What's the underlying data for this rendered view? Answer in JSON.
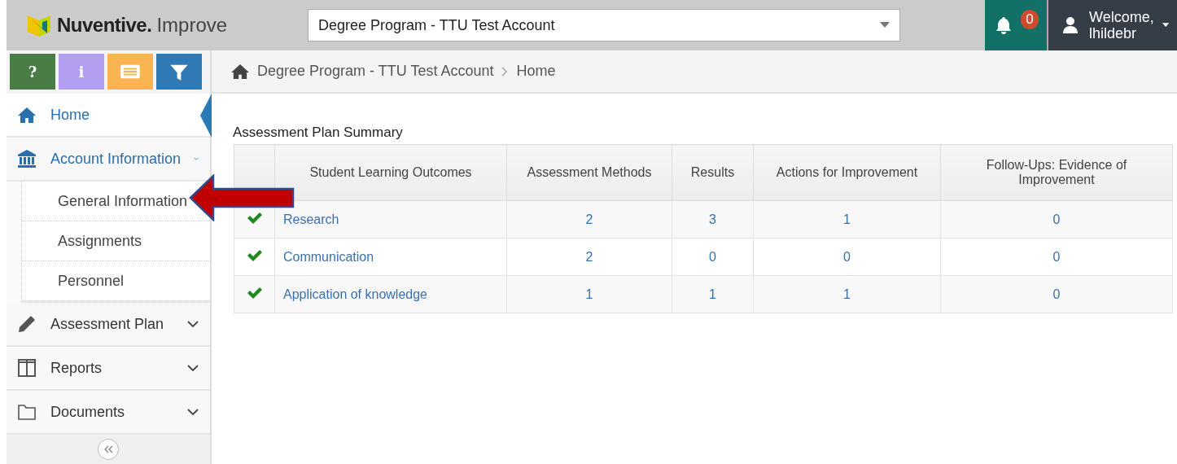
{
  "header": {
    "logo": {
      "brand": "Nuventive.",
      "product": "Improve"
    },
    "account_select": {
      "value": "Degree Program - TTU Test Account"
    },
    "notifications": {
      "count": "0"
    },
    "user": {
      "greeting": "Welcome,",
      "username": "lhildebr"
    }
  },
  "toolbar": [
    {
      "kind": "help",
      "label": "?",
      "color": "#4a7c46"
    },
    {
      "kind": "info",
      "label": "i",
      "color": "#b39ef2"
    },
    {
      "kind": "list",
      "color": "#fbb452"
    },
    {
      "kind": "filter",
      "color": "#2f7ab5"
    }
  ],
  "sidebar": {
    "items": [
      {
        "kind": "home",
        "label": "Home",
        "selected": true
      },
      {
        "kind": "bank",
        "label": "Account Information",
        "selected": false,
        "expanded": true,
        "children": [
          {
            "label": "General Information"
          },
          {
            "label": "Assignments"
          },
          {
            "label": "Personnel"
          }
        ]
      },
      {
        "kind": "pencil",
        "label": "Assessment Plan",
        "selected": false,
        "expanded": false
      },
      {
        "kind": "columns",
        "label": "Reports",
        "selected": false,
        "expanded": false
      },
      {
        "kind": "folder",
        "label": "Documents",
        "selected": false,
        "expanded": false
      }
    ]
  },
  "breadcrumb": [
    "Degree Program - TTU Test Account",
    "Home"
  ],
  "summary": {
    "title": "Assessment Plan Summary",
    "columns": [
      "Student Learning Outcomes",
      "Assessment Methods",
      "Results",
      "Actions for Improvement",
      "Follow-Ups: Evidence of Improvement"
    ],
    "rows": [
      {
        "complete": true,
        "outcome": "Research",
        "counts": [
          "2",
          "3",
          "1",
          "0"
        ]
      },
      {
        "complete": true,
        "outcome": "Communication",
        "counts": [
          "2",
          "0",
          "0",
          "0"
        ]
      },
      {
        "complete": true,
        "outcome": "Application of knowledge",
        "counts": [
          "1",
          "1",
          "1",
          "0"
        ]
      }
    ]
  }
}
